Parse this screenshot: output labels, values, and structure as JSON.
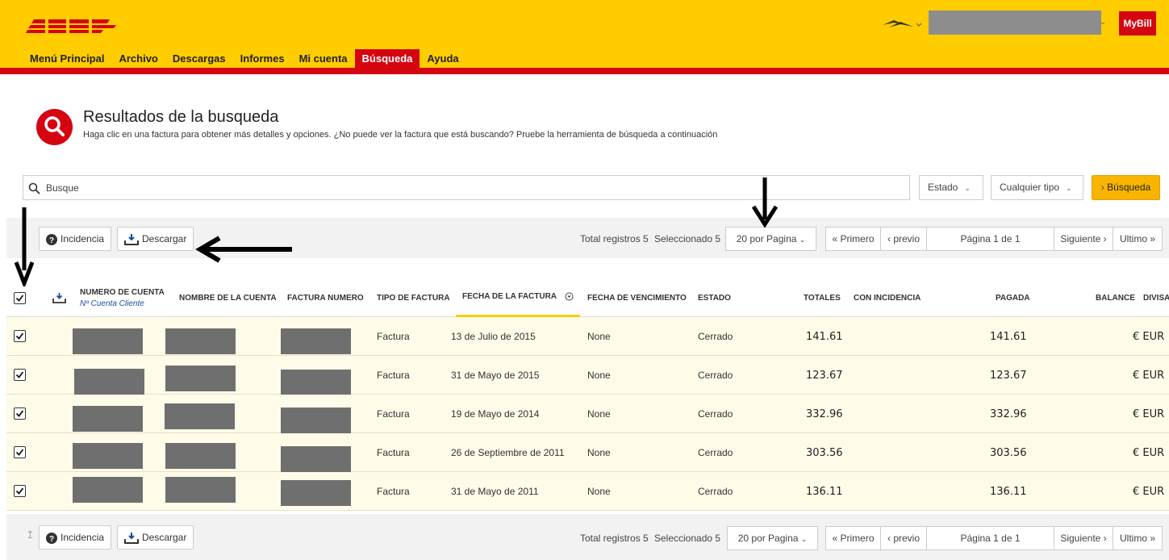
{
  "brand": {
    "logo": "DHL",
    "mybill": "MyBill"
  },
  "nav": [
    {
      "label": "Menú Principal",
      "active": false
    },
    {
      "label": "Archivo",
      "active": false
    },
    {
      "label": "Descargas",
      "active": false
    },
    {
      "label": "Informes",
      "active": false
    },
    {
      "label": "Mi cuenta",
      "active": false
    },
    {
      "label": "Búsqueda",
      "active": true
    },
    {
      "label": "Ayuda",
      "active": false
    }
  ],
  "page": {
    "title": "Resultados de la busqueda",
    "subtitle": "Haga clic en una factura para obtener más detalles y opciones. ¿No puede ver la factura que está buscando? Pruebe la herramienta de búsqueda a continuación"
  },
  "search": {
    "placeholder": "Busque",
    "estado": "Estado",
    "tipo": "Cualquier tipo",
    "button": "Búsqueda"
  },
  "toolbar": {
    "incidencia": "Incidencia",
    "descargar": "Descargar",
    "total": "Total registros 5",
    "selected": "Seleccionado 5",
    "per_page": "20 por Pagina",
    "first": "« Primero",
    "prev": "‹ previo",
    "page": "Página 1 de 1",
    "next": "Siguiente ›",
    "last": "Ultimo »"
  },
  "columns": {
    "numero_cuenta": "NUMERO DE CUENTA",
    "numero_cuenta_sub": "Nº Cuenta Cliente",
    "nombre_cuenta": "NOMBRE DE LA CUENTA",
    "factura_numero": "FACTURA NUMERO",
    "tipo_factura": "TIPO DE FACTURA",
    "fecha_factura": "FECHA DE LA FACTURA",
    "fecha_vencimiento": "FECHA DE VENCIMIENTO",
    "estado": "ESTADO",
    "totales": "TOTALES",
    "con_incidencia": "CON INCIDENCIA",
    "pagada": "PAGADA",
    "balance": "BALANCE",
    "divisa": "DIVISA"
  },
  "rows": [
    {
      "tipo": "Factura",
      "fecha": "13 de Julio de 2015",
      "vencimiento": "None",
      "estado": "Cerrado",
      "total": "141.61",
      "pagada": "141.61",
      "divisa": "€ EUR",
      "checked": true
    },
    {
      "tipo": "Factura",
      "fecha": "31 de Mayo de 2015",
      "vencimiento": "None",
      "estado": "Cerrado",
      "total": "123.67",
      "pagada": "123.67",
      "divisa": "€ EUR",
      "checked": true
    },
    {
      "tipo": "Factura",
      "fecha": "19 de Mayo de 2014",
      "vencimiento": "None",
      "estado": "Cerrado",
      "total": "332.96",
      "pagada": "332.96",
      "divisa": "€ EUR",
      "checked": true
    },
    {
      "tipo": "Factura",
      "fecha": "26 de Septiembre de 2011",
      "vencimiento": "None",
      "estado": "Cerrado",
      "total": "303.56",
      "pagada": "303.56",
      "divisa": "€ EUR",
      "checked": true
    },
    {
      "tipo": "Factura",
      "fecha": "31 de Mayo de 2011",
      "vencimiento": "None",
      "estado": "Cerrado",
      "total": "136.11",
      "pagada": "136.11",
      "divisa": "€ EUR",
      "checked": true
    }
  ],
  "colors": {
    "brand_yellow": "#ffcc00",
    "brand_red": "#d40511",
    "row_bg": "#fffbe9"
  }
}
